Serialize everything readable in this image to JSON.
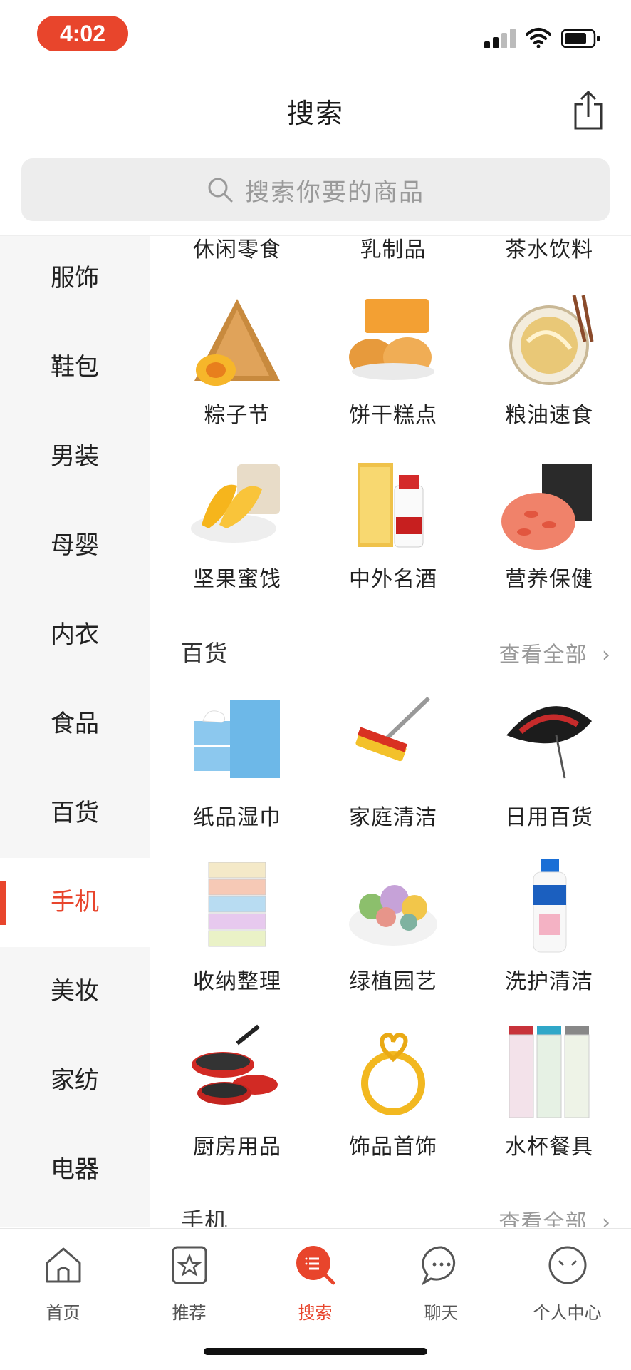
{
  "status_bar": {
    "time": "4:02"
  },
  "header": {
    "title": "搜索",
    "share_icon": "share-icon"
  },
  "search": {
    "placeholder": "搜索你要的商品",
    "icon": "search-icon"
  },
  "sidebar": {
    "active_item": "手机",
    "items": [
      "服饰",
      "鞋包",
      "男装",
      "母婴",
      "内衣",
      "食品",
      "百货",
      "手机",
      "美妆",
      "家纺",
      "电器"
    ]
  },
  "food_section": {
    "partial_row": [
      "休闲零食",
      "乳制品",
      "茶水饮料"
    ],
    "rows": [
      [
        "粽子节",
        "饼干糕点",
        "粮油速食"
      ],
      [
        "坚果蜜饯",
        "中外名酒",
        "营养保健"
      ]
    ]
  },
  "department_section": {
    "title": "百货",
    "view_all": "查看全部",
    "rows": [
      [
        "纸品湿巾",
        "家庭清洁",
        "日用百货"
      ],
      [
        "收纳整理",
        "绿植园艺",
        "洗护清洁"
      ],
      [
        "厨房用品",
        "饰品首饰",
        "水杯餐具"
      ]
    ]
  },
  "phone_section": {
    "title": "手机",
    "view_all": "查看全部"
  },
  "tabbar": {
    "active": "搜索",
    "tabs": [
      {
        "label": "首页",
        "icon": "home-icon"
      },
      {
        "label": "推荐",
        "icon": "star-icon"
      },
      {
        "label": "搜索",
        "icon": "search-list-icon"
      },
      {
        "label": "聊天",
        "icon": "chat-icon"
      },
      {
        "label": "个人中心",
        "icon": "profile-icon"
      }
    ]
  },
  "colors": {
    "accent": "#e8452c",
    "sidebar_bg": "#f6f6f6",
    "search_bg": "#ededed"
  }
}
